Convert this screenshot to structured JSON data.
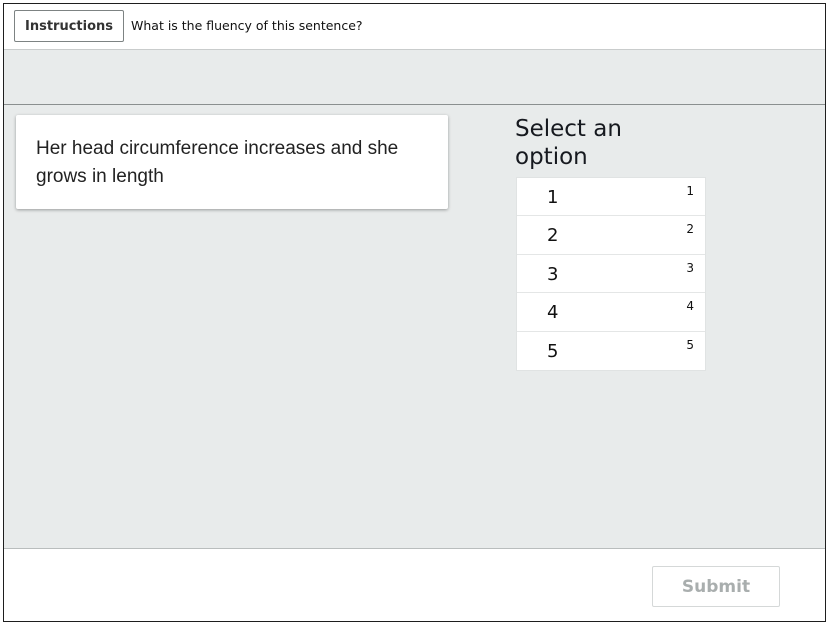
{
  "header": {
    "instructions_label": "Instructions",
    "question": "What is the fluency of this sentence?"
  },
  "content": {
    "sentence": "Her head circumference increases and she grows in length"
  },
  "options_panel": {
    "title": "Select an option",
    "options": [
      {
        "label": "1",
        "key": "1"
      },
      {
        "label": "2",
        "key": "2"
      },
      {
        "label": "3",
        "key": "3"
      },
      {
        "label": "4",
        "key": "4"
      },
      {
        "label": "5",
        "key": "5"
      }
    ]
  },
  "footer": {
    "submit_label": "Submit",
    "submit_enabled": false
  },
  "colors": {
    "workspace_background": "#e8ebeb",
    "submit_disabled_text": "#a9aeae"
  }
}
